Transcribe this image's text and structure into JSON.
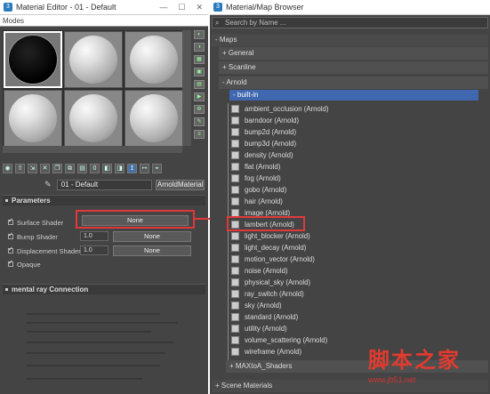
{
  "editor": {
    "title": "Material Editor - 01 - Default",
    "menu": "Modes",
    "material_name": "01 - Default",
    "material_type": "ArnoldMaterial",
    "sections": {
      "parameters": "Parameters",
      "mental_ray": "mental ray Connection"
    },
    "params": [
      {
        "label": "Surface Shader",
        "value": "",
        "button": "None"
      },
      {
        "label": "Bump Shader",
        "value": "1.0",
        "button": "None"
      },
      {
        "label": "Displacement Shader",
        "value": "1.0",
        "button": "None"
      },
      {
        "label": "Opaque",
        "value": "",
        "button": ""
      }
    ]
  },
  "browser": {
    "title": "Material/Map Browser",
    "search_placeholder": "Search by Name ...",
    "groups": {
      "maps": "- Maps",
      "general": "+ General",
      "scanline": "+ Scanline",
      "arnold": "- Arnold",
      "builtin": "- built-in",
      "maxtoa": "+ MAXtoA_Shaders",
      "scene": "+ Scene Materials"
    },
    "items": [
      "ambient_occlusion (Arnold)",
      "barndoor (Arnold)",
      "bump2d (Arnold)",
      "bump3d (Arnold)",
      "density (Arnold)",
      "flat (Arnold)",
      "fog (Arnold)",
      "gobo (Arnold)",
      "hair (Arnold)",
      "image (Arnold)",
      "lambert (Arnold)",
      "light_blocker (Arnold)",
      "light_decay (Arnold)",
      "motion_vector (Arnold)",
      "noise (Arnold)",
      "physical_sky (Arnold)",
      "ray_switch (Arnold)",
      "sky (Arnold)",
      "standard (Arnold)",
      "utility (Arnold)",
      "volume_scattering (Arnold)",
      "wireframe (Arnold)"
    ]
  },
  "watermark": {
    "title": "脚本之家",
    "url": "www.jb51.net"
  }
}
